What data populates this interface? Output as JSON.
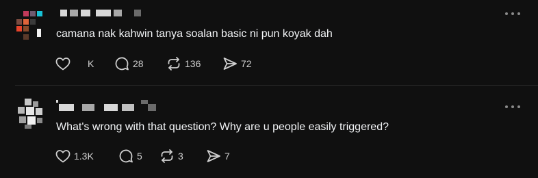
{
  "colors": {
    "background": "#101010",
    "text": "#f3f5f7",
    "muted": "#cfcfcf",
    "divider": "#2a2a2a"
  },
  "posts": [
    {
      "text": "camana nak kahwin tanya soalan basic ni pun koyak dah",
      "actions": {
        "like": {
          "icon": "heart-icon",
          "count": "K"
        },
        "reply": {
          "icon": "comment-icon",
          "count": "28"
        },
        "repost": {
          "icon": "repost-icon",
          "count": "136"
        },
        "share": {
          "icon": "send-icon",
          "count": "72"
        }
      }
    },
    {
      "text": "What's wrong with that question? Why are u people easily triggered?",
      "actions": {
        "like": {
          "icon": "heart-icon",
          "count": "1.3K"
        },
        "reply": {
          "icon": "comment-icon",
          "count": "5"
        },
        "repost": {
          "icon": "repost-icon",
          "count": "3"
        },
        "share": {
          "icon": "send-icon",
          "count": "7"
        }
      }
    }
  ]
}
